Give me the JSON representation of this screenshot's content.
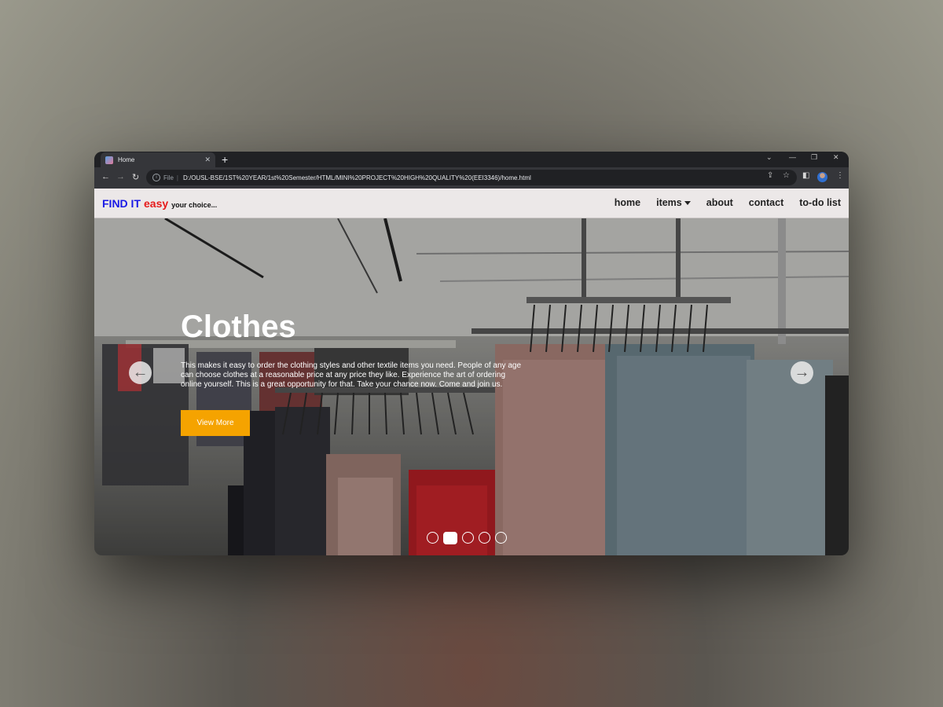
{
  "browser": {
    "tab_title": "Home",
    "new_tab_symbol": "+",
    "address_scheme": "File",
    "address": "D:/OUSL-BSE/1ST%20YEAR/1st%20Semester/HTML/MINI%20PROJECT%20HIGH%20QUALITY%20(EEI3346)/home.html"
  },
  "site": {
    "brand_part1": "FIND IT",
    "brand_part2": "easy",
    "brand_tagline": "your choice...",
    "nav": {
      "home": "home",
      "items": "items",
      "about": "about",
      "contact": "contact",
      "todo": "to-do list"
    }
  },
  "hero": {
    "title": "Clothes",
    "description": "This makes it easy to order the clothing styles and other textile items you need. People of any age can choose clothes at a reasonable price at any price they like. Experience the art of ordering online yourself. This is a great opportunity for that. Take your chance now. Come and join us.",
    "button_label": "View More",
    "slide_count": 5,
    "active_slide": 2
  },
  "colors": {
    "brand_blue": "#1a1ae6",
    "brand_red": "#e61a1a",
    "button_orange": "#f5a300"
  }
}
